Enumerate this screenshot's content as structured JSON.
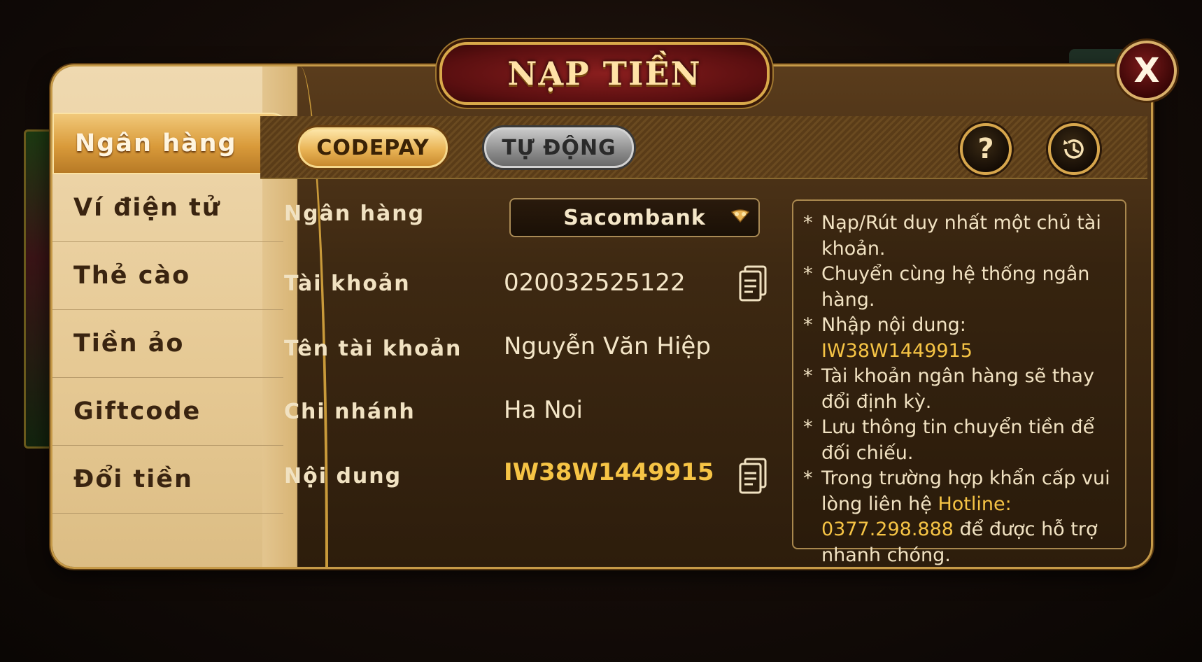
{
  "title": "NẠP TIỀN",
  "close_label": "X",
  "sidebar": {
    "items": [
      {
        "label": "Ngân hàng",
        "active": true
      },
      {
        "label": "Ví điện tử",
        "active": false
      },
      {
        "label": "Thẻ cào",
        "active": false
      },
      {
        "label": "Tiền ảo",
        "active": false
      },
      {
        "label": "Giftcode",
        "active": false
      },
      {
        "label": "Đổi tiền",
        "active": false
      }
    ]
  },
  "tabs": {
    "codepay": "CODEPAY",
    "auto": "TỰ ĐỘNG"
  },
  "buttons": {
    "help": "?",
    "history_icon": "history-icon"
  },
  "form": {
    "bank_label": "Ngân hàng",
    "bank_value": "Sacombank",
    "account_label": "Tài khoản",
    "account_value": "020032525122",
    "account_name_label": "Tên tài khoản",
    "account_name_value": "Nguyễn Văn Hiệp",
    "branch_label": "Chi nhánh",
    "branch_value": "Ha Noi",
    "content_label": "Nội dung",
    "content_value": "IW38W1449915"
  },
  "info": {
    "star": "*",
    "line1": "Nạp/Rút duy nhất một chủ tài khoản.",
    "line2": "Chuyển cùng hệ thống ngân hàng.",
    "line3_prefix": "Nhập nội dung: ",
    "line3_code": "IW38W1449915",
    "line4": "Tài khoản ngân hàng sẽ thay đổi định kỳ.",
    "line5": "Lưu thông tin chuyển tiền để đối chiếu.",
    "line6_prefix": "Trong trường hợp khẩn cấp vui lòng liên hệ ",
    "line6_hotline": "Hotline: 0377.298.888",
    "line6_suffix": " để được hỗ trợ nhanh chóng."
  },
  "colors": {
    "accent_gold": "#f6c445",
    "title_red": "#8a1e1e",
    "sidebar_bg": "#efd9b0"
  }
}
